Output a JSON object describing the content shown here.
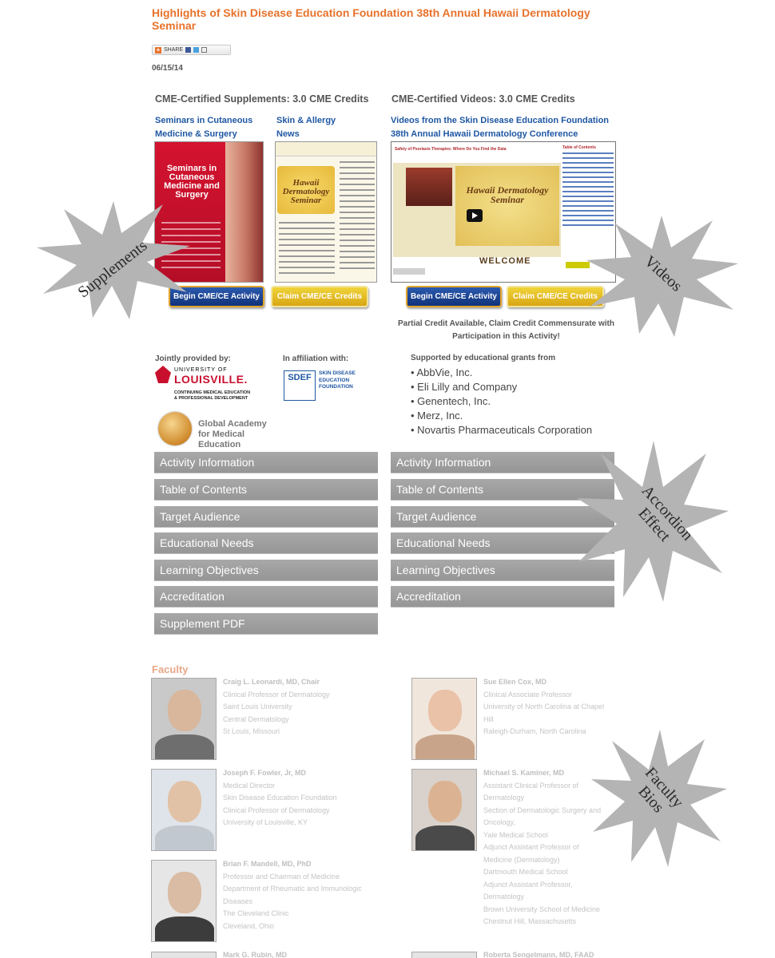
{
  "page": {
    "title": "Highlights of Skin Disease Education Foundation 38th Annual Hawaii Dermatology Seminar",
    "share_label": "SHARE",
    "date": "06/15/14"
  },
  "supplements": {
    "heading": "CME-Certified Supplements: 3.0 CME Credits",
    "links": [
      {
        "line1": "Seminars in Cutaneous",
        "line2": "Medicine & Surgery"
      },
      {
        "line1": "Skin & Allergy",
        "line2": "News"
      }
    ],
    "cover_seminars_text": "Seminars in Cutaneous Medicine and Surgery",
    "cover_hawaii_text": "Hawaii Dermatology Seminar",
    "begin_button": "Begin CME/CE Activity",
    "claim_button": "Claim CME/CE Credits"
  },
  "videos": {
    "heading": "CME-Certified Videos:  3.0 CME Credits",
    "link_line1": "Videos from the Skin Disease Education Foundation",
    "link_line2": "38th Annual Hawaii Dermatology Conference",
    "video_title": "Safety of Psoriasis Therapies: Where Do You Find the Data",
    "poster_text": "Hawaii Dermatology Seminar",
    "welcome": "WELCOME",
    "toc_title": "Table of Contents",
    "begin_button": "Begin CME/CE Activity",
    "claim_button": "Claim CME/CE Credits",
    "partial_credit": "Partial Credit Available, Claim Credit Commensurate with Participation in this Activity!"
  },
  "providers": {
    "jointly_label": "Jointly provided by:",
    "louisville_university": "UNIVERSITY OF",
    "louisville_name": "LOUISVILLE.",
    "louisville_dept": "CONTINUING MEDICAL EDUCATION & PROFESSIONAL DEVELOPMENT",
    "gam_name": "Global Academy for Medical Education",
    "affiliation_label": "In affiliation with:",
    "sdef_logo": "SDEF",
    "sdef_name": "SKIN DISEASE EDUCATION FOUNDATION",
    "support_label": "Supported by educational grants from",
    "grants": [
      "• AbbVie, Inc.",
      "• Eli Lilly and Company",
      "• Genentech, Inc.",
      "• Merz, Inc.",
      "• Novartis Pharmaceuticals Corporation"
    ]
  },
  "accordion_left": [
    "Activity Information",
    "Table of Contents",
    "Target Audience",
    "Educational Needs",
    "Learning Objectives",
    "Accreditation",
    "Supplement PDF"
  ],
  "accordion_right": [
    "Activity Information",
    "Table of Contents",
    "Target Audience",
    "Educational Needs",
    "Learning Objectives",
    "Accreditation"
  ],
  "faculty": {
    "label": "Faculty",
    "members": [
      {
        "name": "Craig L. Leonardi, MD, Chair",
        "lines": [
          "Clinical Professor of Dermatology",
          "Saint Louis University",
          "Central Dermatology",
          "St Louis, Missouri"
        ]
      },
      {
        "name": "Sue Ellen Cox, MD",
        "lines": [
          "Clinical Associate Professor",
          "University of North Carolina at Chapel",
          "Hill",
          "Raleigh-Durham, North Carolina"
        ]
      },
      {
        "name": "Joseph F. Fowler, Jr, MD",
        "lines": [
          "Medical Director",
          "Skin Disease Education Foundation",
          "Clinical Professor of Dermatology",
          "University of Louisville, KY"
        ]
      },
      {
        "name": "Michael S. Kaminer, MD",
        "lines": [
          "Assistant Clinical Professor of",
          "Dermatology",
          "Section of Dermatologic Surgery and",
          "Oncology,",
          "Yale Medical School",
          "Adjunct Assistant Professor of",
          "Medicine (Dermatology)",
          "Dartmouth Medical School",
          "Adjunct Assistant Professor,",
          "Dermatology",
          "Brown University School of Medicine",
          "Chestnut Hill, Massachusetts"
        ]
      },
      {
        "name": "Brian F. Mandell, MD, PhD",
        "lines": [
          "Professor and Chairman of Medicine",
          "Department of Rheumatic and Immunologic",
          "Diseases",
          "The Cleveland Clinic",
          "Cleveland, Ohio"
        ]
      },
      {
        "name": "Mark G. Rubin, MD",
        "lines": []
      },
      {
        "name": "Roberta Sengelmann, MD, FAAD",
        "lines": []
      }
    ]
  },
  "callouts": {
    "supplements": "Supplements",
    "videos": "Videos",
    "accordion_line1": "Accordion",
    "accordion_line2": "Effect",
    "faculty_line1": "Faculty",
    "faculty_line2": "Bios"
  },
  "colors": {
    "title_orange": "#e8722a",
    "link_blue": "#1f57a3",
    "accordion_gray": "#a0a0a0",
    "faculty_label": "#e7a788",
    "starburst": "#b4b4b4"
  }
}
